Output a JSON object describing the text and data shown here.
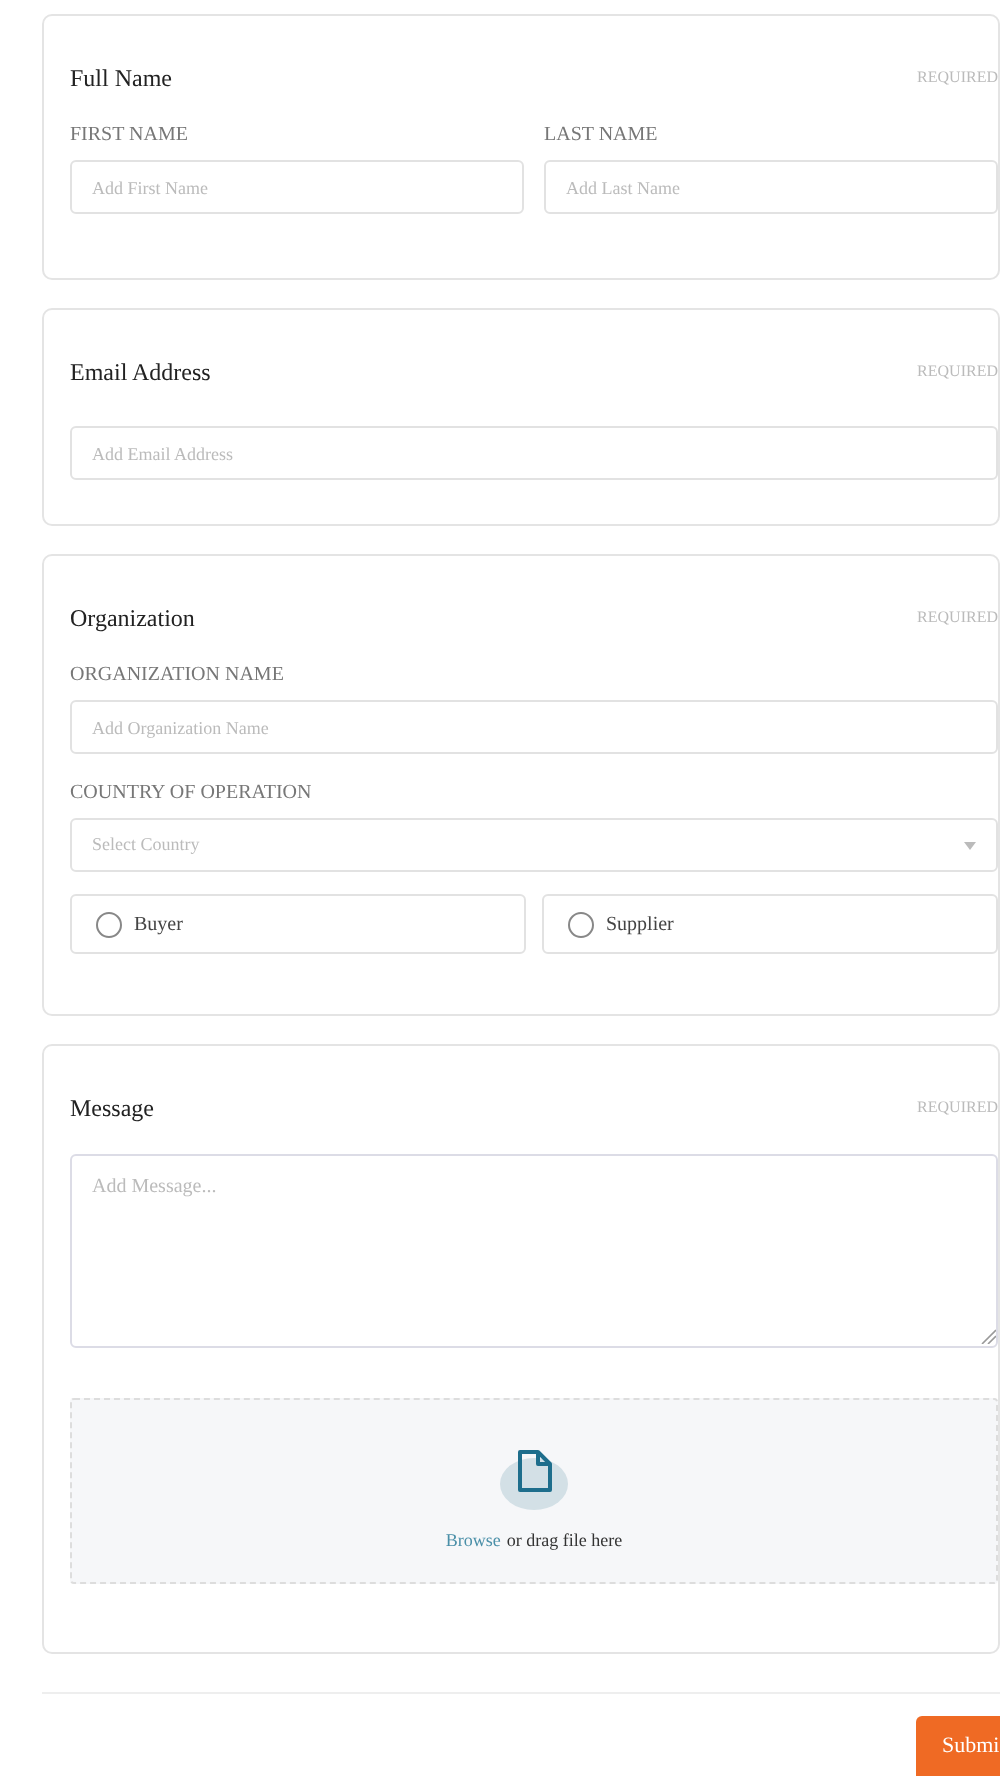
{
  "sections": [
    {
      "title": "Full Name",
      "badge": "REQUIRED",
      "fields": [
        {
          "kind": "pair",
          "items": [
            {
              "label": "FIRST NAME",
              "placeholder": "Add First Name"
            },
            {
              "label": "LAST NAME",
              "placeholder": "Add Last Name"
            }
          ]
        }
      ]
    },
    {
      "title": "Email Address",
      "badge": "REQUIRED",
      "fields": [
        {
          "kind": "text",
          "placeholder": "Add Email Address"
        }
      ]
    },
    {
      "title": "Organization",
      "badge": "REQUIRED",
      "fields": [
        {
          "kind": "text",
          "label": "ORGANIZATION NAME",
          "placeholder": "Add Organization Name"
        },
        {
          "kind": "select",
          "label": "COUNTRY OF OPERATION",
          "placeholder": "Select Country"
        },
        {
          "kind": "radios",
          "options": [
            {
              "label": "Buyer",
              "selected": false
            },
            {
              "label": "Supplier",
              "selected": false
            }
          ]
        }
      ]
    },
    {
      "title": "Message",
      "badge": "REQUIRED",
      "fields": [
        {
          "kind": "textarea",
          "placeholder": "Add Message..."
        },
        {
          "kind": "upload",
          "link": "Browse",
          "text": "or drag file here"
        }
      ]
    }
  ],
  "submit": "Submi"
}
